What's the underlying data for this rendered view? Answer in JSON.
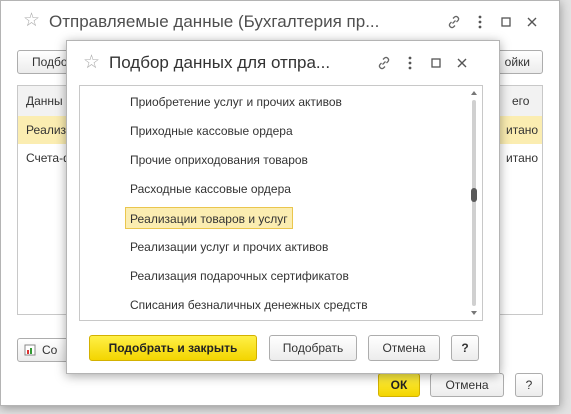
{
  "back_window": {
    "title": "Отправляемые данные (Бухгалтерия пр...",
    "toolbar_left": "Подбо",
    "toolbar_right": "ойки",
    "col_header_left": "Данны",
    "col_header_right": "его",
    "rows": [
      {
        "left": "Реализ",
        "right": "итано"
      },
      {
        "left": "Счета-ф",
        "right": "итано"
      }
    ],
    "bottom_left_button": "Со",
    "ok_label": "ОК",
    "cancel_label": "Отмена",
    "help_label": "?"
  },
  "dialog": {
    "title": "Подбор данных для отпра...",
    "items": [
      "Приобретение услуг и прочих активов",
      "Приходные кассовые ордера",
      "Прочие оприходования товаров",
      "Расходные кассовые ордера",
      "Реализации товаров и услуг",
      "Реализации услуг и прочих активов",
      "Реализация подарочных сертификатов",
      "Списания безналичных денежных средств"
    ],
    "selected_index": 4,
    "buttons": {
      "select_close": "Подобрать и закрыть",
      "select": "Подобрать",
      "cancel": "Отмена",
      "help": "?"
    }
  },
  "colors": {
    "accent_yellow": "#f5dc14",
    "selection_bg": "#fbedb1",
    "selection_border": "#eac64e"
  }
}
